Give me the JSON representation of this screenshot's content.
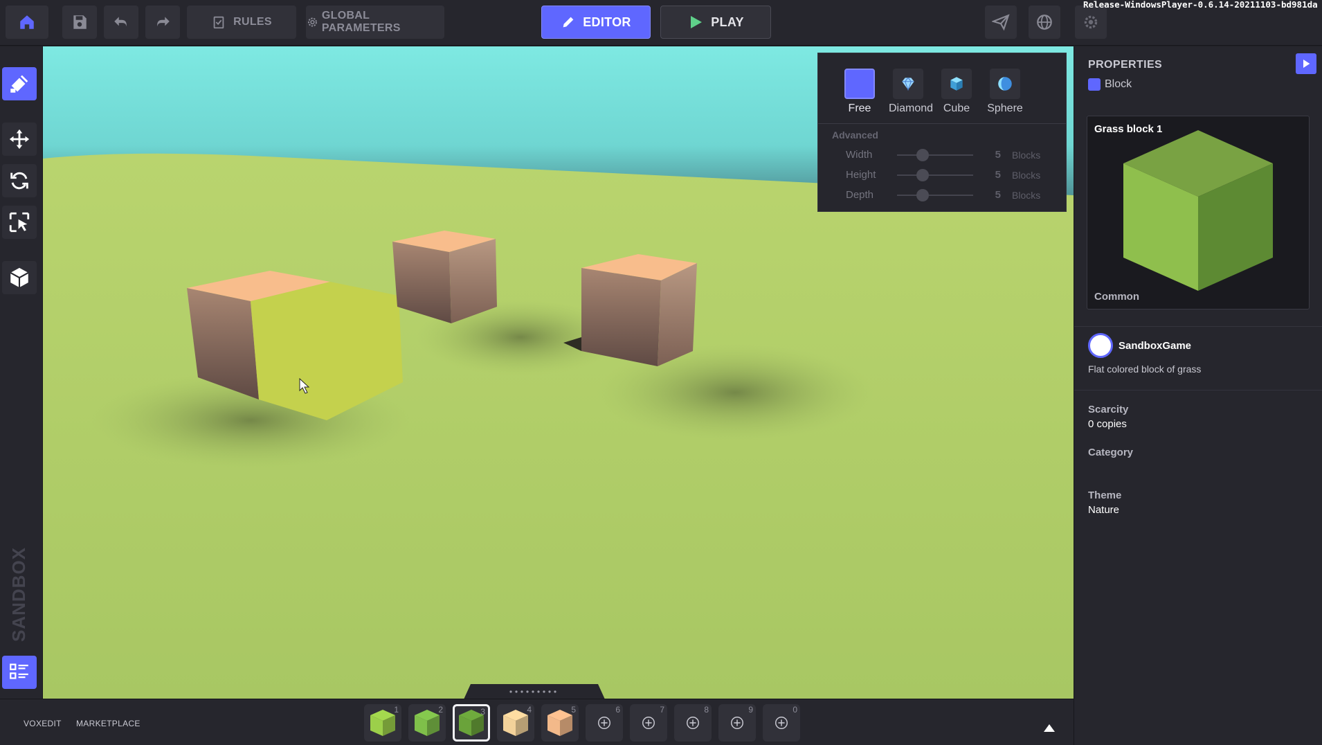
{
  "topbar": {
    "rules_label": "RULES",
    "global_params_label": "GLOBAL PARAMETERS",
    "editor_label": "EDITOR",
    "play_label": "PLAY",
    "release_text": "Release-WindowsPlayer-0.6.14-20211103-bd981da"
  },
  "brush_panel": {
    "shapes": [
      {
        "label": "Free",
        "icon": "free-brush-icon",
        "active": true
      },
      {
        "label": "Diamond",
        "icon": "diamond-icon",
        "active": false
      },
      {
        "label": "Cube",
        "icon": "cube-icon",
        "active": false
      },
      {
        "label": "Sphere",
        "icon": "sphere-icon",
        "active": false
      }
    ],
    "advanced_label": "Advanced",
    "dims": [
      {
        "label": "Width",
        "value": "5",
        "unit": "Blocks"
      },
      {
        "label": "Height",
        "value": "5",
        "unit": "Blocks"
      },
      {
        "label": "Depth",
        "value": "5",
        "unit": "Blocks"
      }
    ]
  },
  "bottombar": {
    "voxedit_label": "VOXEDIT",
    "marketplace_label": "MARKETPLACE",
    "slots": [
      {
        "num": "1",
        "kind": "block",
        "color": "#9ccf4a"
      },
      {
        "num": "2",
        "kind": "block",
        "color": "#7fbf4a"
      },
      {
        "num": "3",
        "kind": "block",
        "color": "#6aa33a",
        "selected": true
      },
      {
        "num": "4",
        "kind": "block",
        "color": "#f3d29a"
      },
      {
        "num": "5",
        "kind": "block",
        "color": "#f3b98a"
      },
      {
        "num": "6",
        "kind": "empty"
      },
      {
        "num": "7",
        "kind": "empty"
      },
      {
        "num": "8",
        "kind": "empty"
      },
      {
        "num": "9",
        "kind": "empty"
      },
      {
        "num": "0",
        "kind": "empty"
      }
    ]
  },
  "properties": {
    "title": "PROPERTIES",
    "type_label": "Block",
    "preview_name": "Grass block 1",
    "preview_rarity": "Common",
    "creator": "SandboxGame",
    "description": "Flat colored block of grass",
    "scarcity_label": "Scarcity",
    "scarcity_value": "0 copies",
    "category_label": "Category",
    "category_value": "",
    "theme_label": "Theme",
    "theme_value": "Nature"
  },
  "colors": {
    "accent": "#5f67ff",
    "panel": "#26262d",
    "ground": "#b3cf6a",
    "sky": "#72e6e0",
    "grass_top": "#79a243",
    "grass_left": "#8fbf4d",
    "grass_right": "#5d8a33"
  }
}
